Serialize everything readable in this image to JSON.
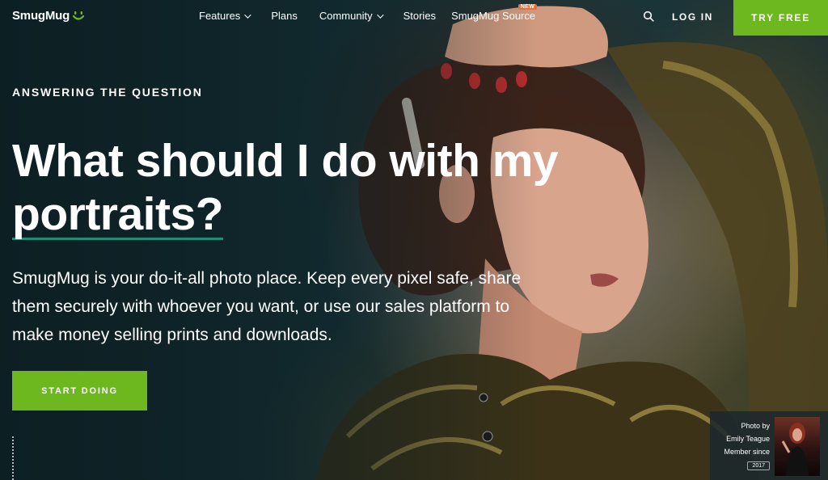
{
  "nav": {
    "logo": "SmugMug",
    "items": [
      {
        "label": "Features",
        "dropdown": true
      },
      {
        "label": "Plans",
        "dropdown": false
      },
      {
        "label": "Community",
        "dropdown": true
      },
      {
        "label": "Stories",
        "dropdown": false
      }
    ],
    "source_label": "SmugMug Source",
    "new_badge": "NEW",
    "login": "LOG IN",
    "try_free": "TRY FREE",
    "search_icon": "search-icon"
  },
  "hero": {
    "eyebrow": "ANSWERING THE QUESTION",
    "headline_line1": "What should I do with my",
    "headline_line2": "portraits?",
    "lede": "SmugMug is your do-it-all photo place. Keep every pixel safe, share them securely with whoever you want, or use our sales platform to make money selling prints and downloads.",
    "cta": "START DOING"
  },
  "credit": {
    "line1": "Photo by",
    "name": "Emily Teague",
    "member_since": "Member since",
    "year": "2017"
  },
  "colors": {
    "accent_green": "#6db81f",
    "underline_teal": "#1f8c7a",
    "new_badge": "#e9703a"
  }
}
